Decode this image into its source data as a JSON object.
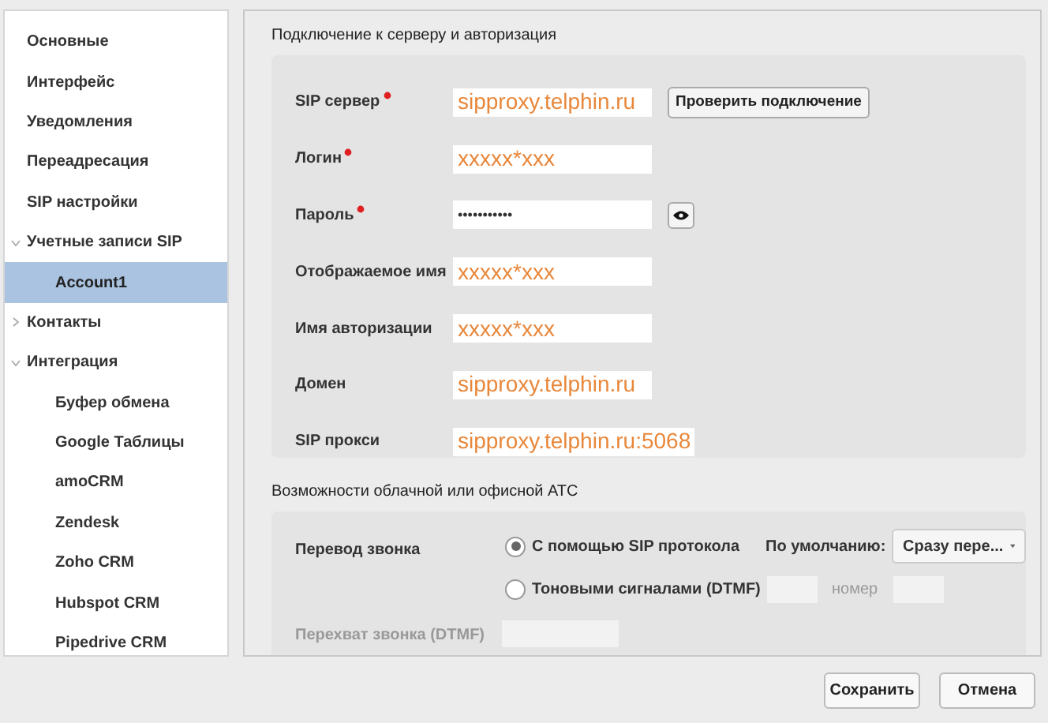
{
  "sidebar": {
    "items": [
      {
        "label": "Основные",
        "selected": false
      },
      {
        "label": "Интерфейс",
        "selected": false
      },
      {
        "label": "Уведомления",
        "selected": false
      },
      {
        "label": "Переадресация",
        "selected": false
      },
      {
        "label": "SIP настройки",
        "selected": false
      },
      {
        "label": "Учетные записи SIP",
        "selected": false,
        "expanded": true,
        "children": [
          {
            "label": "Account1",
            "selected": true
          }
        ]
      },
      {
        "label": "Контакты",
        "selected": false,
        "expanded": false
      },
      {
        "label": "Интеграция",
        "selected": false,
        "expanded": true,
        "children": [
          {
            "label": "Буфер обмена",
            "selected": false
          },
          {
            "label": "Google Таблицы",
            "selected": false
          },
          {
            "label": "amoCRM",
            "selected": false
          },
          {
            "label": "Zendesk",
            "selected": false
          },
          {
            "label": "Zoho CRM",
            "selected": false
          },
          {
            "label": "Hubspot CRM",
            "selected": false
          },
          {
            "label": "Pipedrive CRM",
            "selected": false
          }
        ]
      }
    ]
  },
  "server_section": {
    "title": "Подключение к серверу и авторизация",
    "fields": [
      {
        "label": "SIP сервер",
        "required": true,
        "value": "sipproxy.telphin.ru",
        "kind": "text",
        "button": "Проверить подключение"
      },
      {
        "label": "Логин",
        "required": true,
        "value": "xxxxx*xxx",
        "kind": "text"
      },
      {
        "label": "Пароль",
        "required": true,
        "value": "•••••••••••",
        "kind": "password"
      },
      {
        "label": "Отображаемое имя",
        "required": false,
        "value": "xxxxx*xxx",
        "kind": "text"
      },
      {
        "label": "Имя авторизации",
        "required": false,
        "value": "xxxxx*xxx",
        "kind": "text"
      },
      {
        "label": "Домен",
        "required": false,
        "value": "sipproxy.telphin.ru",
        "kind": "text"
      },
      {
        "label": "SIP прокси",
        "required": false,
        "value": "sipproxy.telphin.ru:5068",
        "kind": "text"
      }
    ]
  },
  "pbx_section": {
    "title": "Возможности облачной или офисной АТС",
    "transfer": {
      "label": "Перевод звонка",
      "options": [
        {
          "label": "С помощью SIP протокола",
          "selected": true
        },
        {
          "label": "Тоновыми сигналами (DTMF)",
          "selected": false
        }
      ],
      "default_label": "По умолчанию:",
      "default_value": "Сразу пере...",
      "number_label": "номер"
    },
    "intercept": {
      "label": "Перехват звонка (DTMF)",
      "disabled": true
    }
  },
  "buttons": [
    "Сохранить",
    "Отмена"
  ]
}
